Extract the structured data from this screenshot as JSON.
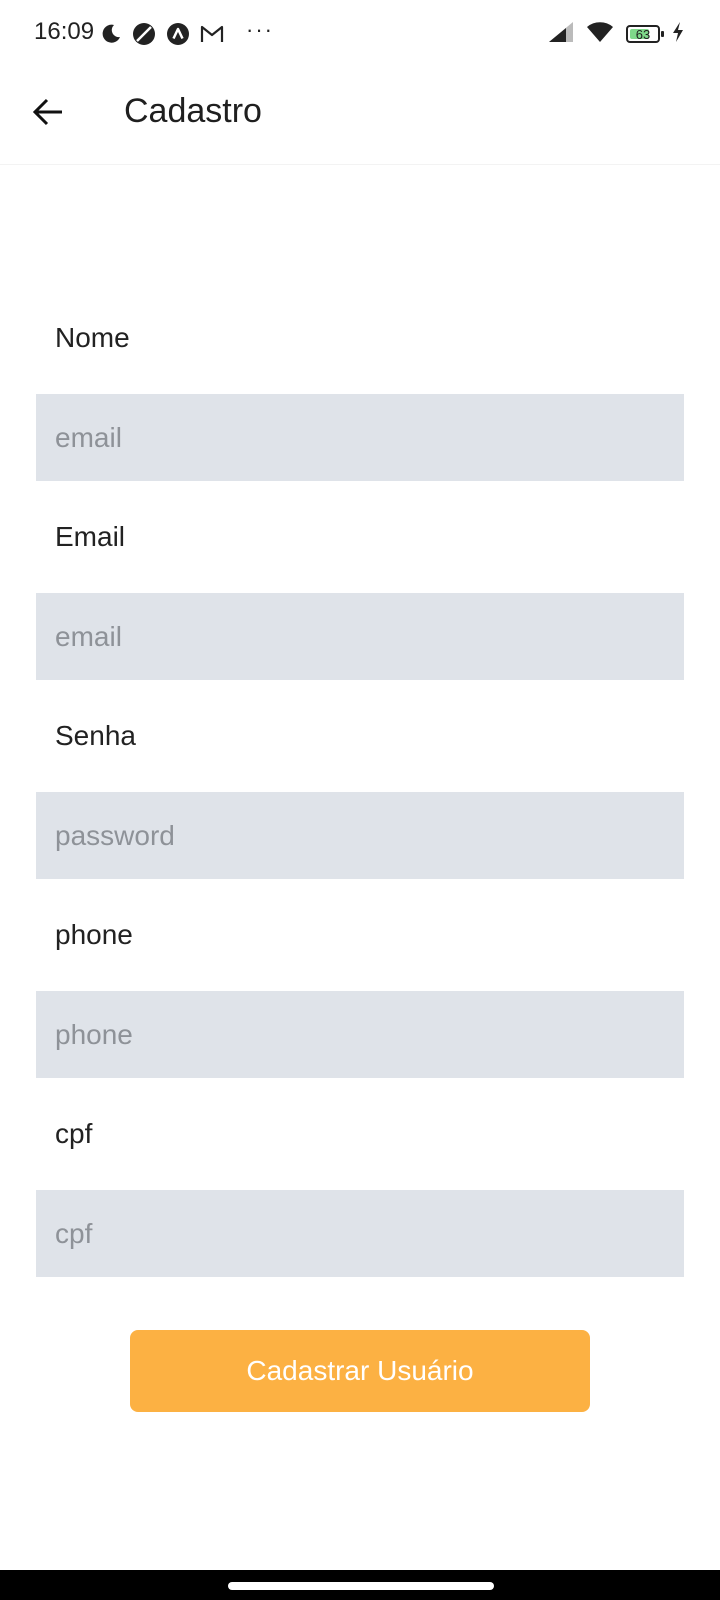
{
  "status_bar": {
    "time": "16:09",
    "battery_level": "63",
    "icons_left": [
      "moon-icon",
      "blocked-circle-icon",
      "triangle-circle-icon",
      "gmail-icon"
    ],
    "icons_right": [
      "cellular-signal-icon",
      "wifi-icon",
      "battery-icon",
      "charging-bolt-icon"
    ],
    "overflow": "···"
  },
  "app_bar": {
    "back_icon": "back-arrow-icon",
    "title": "Cadastro"
  },
  "form": {
    "fields": [
      {
        "label": "Nome",
        "placeholder": "email",
        "value": ""
      },
      {
        "label": "Email",
        "placeholder": "email",
        "value": ""
      },
      {
        "label": "Senha",
        "placeholder": "password",
        "value": ""
      },
      {
        "label": "phone",
        "placeholder": "phone",
        "value": ""
      },
      {
        "label": "cpf",
        "placeholder": "cpf",
        "value": ""
      }
    ],
    "submit_label": "Cadastrar Usuário"
  },
  "colors": {
    "accent": "#fcb143",
    "input_background": "#dfe3e9",
    "placeholder": "#8e9298",
    "text": "#1f1f1f",
    "battery_fill": "#7fd88a"
  }
}
